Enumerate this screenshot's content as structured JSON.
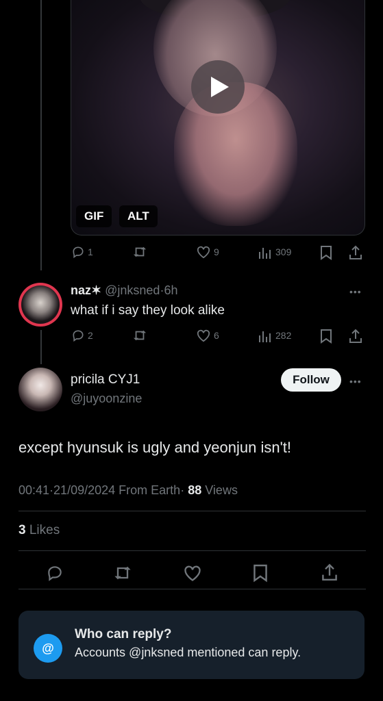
{
  "prev_tweet": {
    "media_badges": {
      "gif": "GIF",
      "alt": "ALT"
    },
    "actions": {
      "replies": "1",
      "retweets": "",
      "likes": "9",
      "views": "309"
    }
  },
  "reply_tweet": {
    "display_name": "naz✶",
    "handle": "@jnksned",
    "separator": "·",
    "time": "6h",
    "text": "what if i say they look alike",
    "actions": {
      "replies": "2",
      "retweets": "",
      "likes": "6",
      "views": "282"
    }
  },
  "main_tweet": {
    "display_name": "pricila CYJ1",
    "handle": "@juyoonzine",
    "follow_label": "Follow",
    "text": "except hyunsuk is ugly and yeonjun isn't!",
    "time": "00:41",
    "sep1": "·",
    "date": "21/09/2024",
    "source": "From Earth",
    "sep2": "·",
    "views_count": "88",
    "views_label": "Views",
    "likes_count": "3",
    "likes_label": "Likes"
  },
  "who_can_reply": {
    "icon": "@",
    "title": "Who can reply?",
    "subtitle": "Accounts @jnksned mentioned can reply."
  },
  "colors": {
    "accent": "#1d9bf0",
    "muted": "#71767b",
    "background": "#000000",
    "card": "#16202b"
  }
}
